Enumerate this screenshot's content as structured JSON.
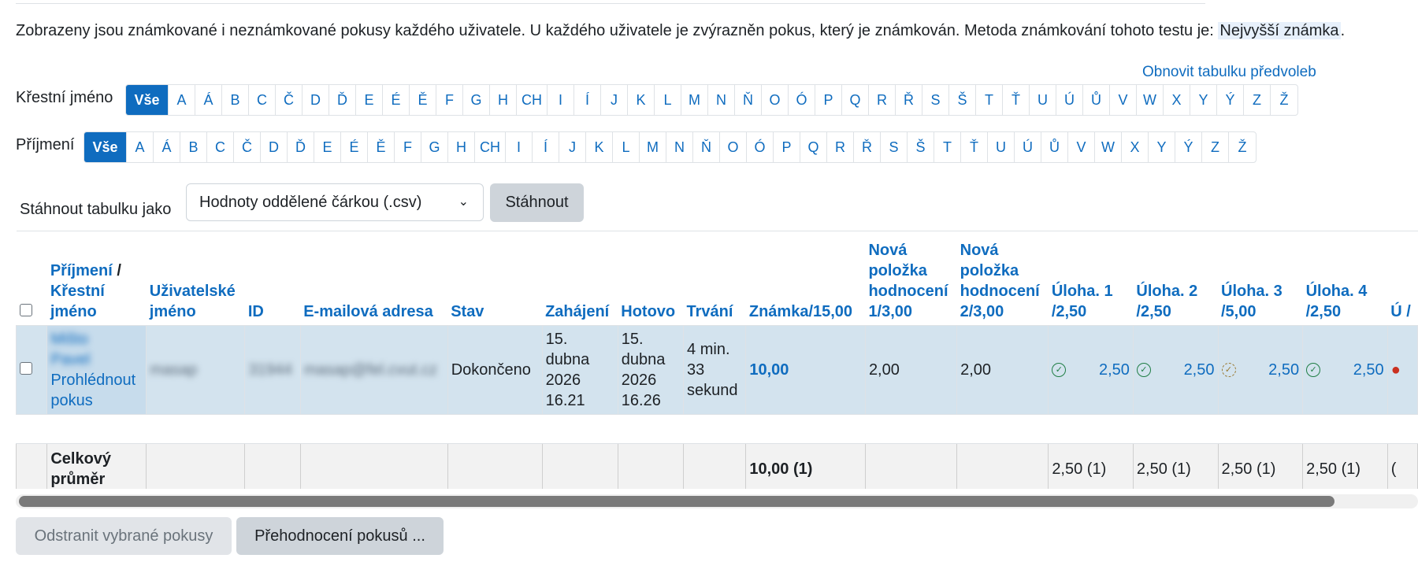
{
  "info_text": "Zobrazeny jsou známkované i neznámkované pokusy každého uživatele. U každého uživatele je zvýrazněn pokus, který je známkován. Metoda známkování tohoto testu je: ",
  "grading_method": "Nejvyšší známka",
  "info_suffix": ".",
  "reset_link": "Obnovit tabulku předvoleb",
  "firstname_filter": {
    "label": "Křestní jméno",
    "letters": [
      "Vše",
      "A",
      "Á",
      "B",
      "C",
      "Č",
      "D",
      "Ď",
      "E",
      "É",
      "Ě",
      "F",
      "G",
      "H",
      "CH",
      "I",
      "Í",
      "J",
      "K",
      "L",
      "M",
      "N",
      "Ň",
      "O",
      "Ó",
      "P",
      "Q",
      "R",
      "Ř",
      "S",
      "Š",
      "T",
      "Ť",
      "U",
      "Ú",
      "Ů",
      "V",
      "W",
      "X",
      "Y",
      "Ý",
      "Z",
      "Ž"
    ]
  },
  "lastname_filter": {
    "label": "Příjmení",
    "letters": [
      "Vše",
      "A",
      "Á",
      "B",
      "C",
      "Č",
      "D",
      "Ď",
      "E",
      "É",
      "Ě",
      "F",
      "G",
      "H",
      "CH",
      "I",
      "Í",
      "J",
      "K",
      "L",
      "M",
      "N",
      "Ň",
      "O",
      "Ó",
      "P",
      "Q",
      "R",
      "Ř",
      "S",
      "Š",
      "T",
      "Ť",
      "U",
      "Ú",
      "Ů",
      "V",
      "W",
      "X",
      "Y",
      "Ý",
      "Z",
      "Ž"
    ]
  },
  "download": {
    "label": "Stáhnout tabulku jako",
    "format": "Hodnoty oddělené čárkou (.csv)",
    "button": "Stáhnout"
  },
  "table": {
    "headers": {
      "lastname": "Příjmení",
      "sep": " /",
      "firstname": "Křestní jméno",
      "username": "Uživatelské jméno",
      "id": "ID",
      "email": "E-mailová adresa",
      "state": "Stav",
      "started": "Zahájení",
      "finished": "Hotovo",
      "duration": "Trvání",
      "grade": "Známka/15,00",
      "item1": "Nová položka hodnocení 1/3,00",
      "item2": "Nová položka hodnocení 2/3,00",
      "q1": "Úloha. 1 /2,50",
      "q2": "Úloha. 2 /2,50",
      "q3": "Úloha. 3 /5,00",
      "q4": "Úloha. 4 /2,50",
      "q5": "Ú /"
    },
    "row": {
      "name_line1": "Mišto",
      "name_line2": "Pavel",
      "review_link": "Prohlédnout pokus",
      "username": "masap",
      "id": "31944",
      "email": "masap@fel.cvut.cz",
      "state": "Dokončeno",
      "started": "15. dubna 2026 16.21",
      "finished": "15. dubna 2026 16.26",
      "duration": "4 min. 33 sekund",
      "grade": "10,00",
      "item1": "2,00",
      "item2": "2,00",
      "q1": "2,50",
      "q2": "2,50",
      "q3": "2,50",
      "q4": "2,50"
    },
    "average": {
      "label": "Celkový průměr",
      "grade": "10,00 (1)",
      "q1": "2,50 (1)",
      "q2": "2,50 (1)",
      "q3": "2,50 (1)",
      "q4": "2,50 (1)",
      "q5": "("
    }
  },
  "actions": {
    "delete": "Odstranit vybrané pokusy",
    "regrade": "Přehodnocení pokusů ..."
  }
}
